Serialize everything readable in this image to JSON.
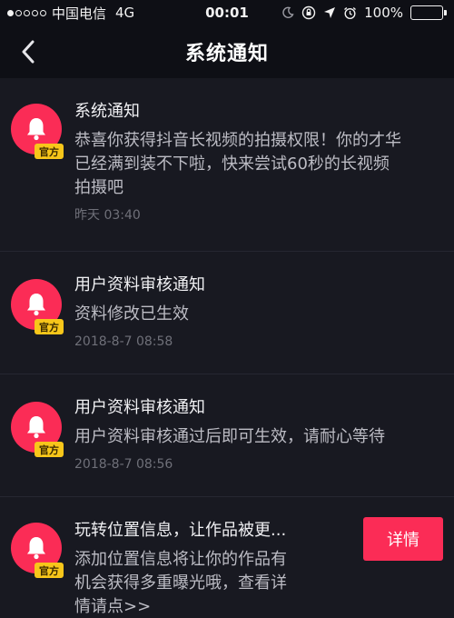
{
  "status_bar": {
    "carrier": "中国电信",
    "network": "4G",
    "time": "00:01",
    "battery": "100%",
    "battery_level": 1.0,
    "icons": [
      "moon-icon",
      "orientation-lock-icon",
      "location-icon",
      "alarm-icon",
      "battery-icon"
    ]
  },
  "nav": {
    "title": "系统通知",
    "back_icon": "chevron-left-icon"
  },
  "badge_label": "官方",
  "colors": {
    "background": "#181921",
    "bar": "#0e0f15",
    "accent": "#fb2c56",
    "badge": "#f7c61a"
  },
  "notifications": [
    {
      "title": "系统通知",
      "body_lines": [
        "恭喜你获得抖音长视频的拍摄权限！你的才华",
        "已经满到装不下啦，快来尝试60秒的长视频",
        "拍摄吧"
      ],
      "time": "昨天 03:40"
    },
    {
      "title": "用户资料审核通知",
      "body_lines": [
        "资料修改已生效"
      ],
      "time": "2018-8-7 08:58"
    },
    {
      "title": "用户资料审核通知",
      "body_lines": [
        "用户资料审核通过后即可生效，请耐心等待"
      ],
      "time": "2018-8-7 08:56"
    },
    {
      "title": "玩转位置信息，让作品被更...",
      "body_lines": [
        "添加位置信息将让你的作品有",
        "机会获得多重曝光哦，查看详",
        "情请点>>"
      ],
      "action_label": "详情"
    }
  ]
}
